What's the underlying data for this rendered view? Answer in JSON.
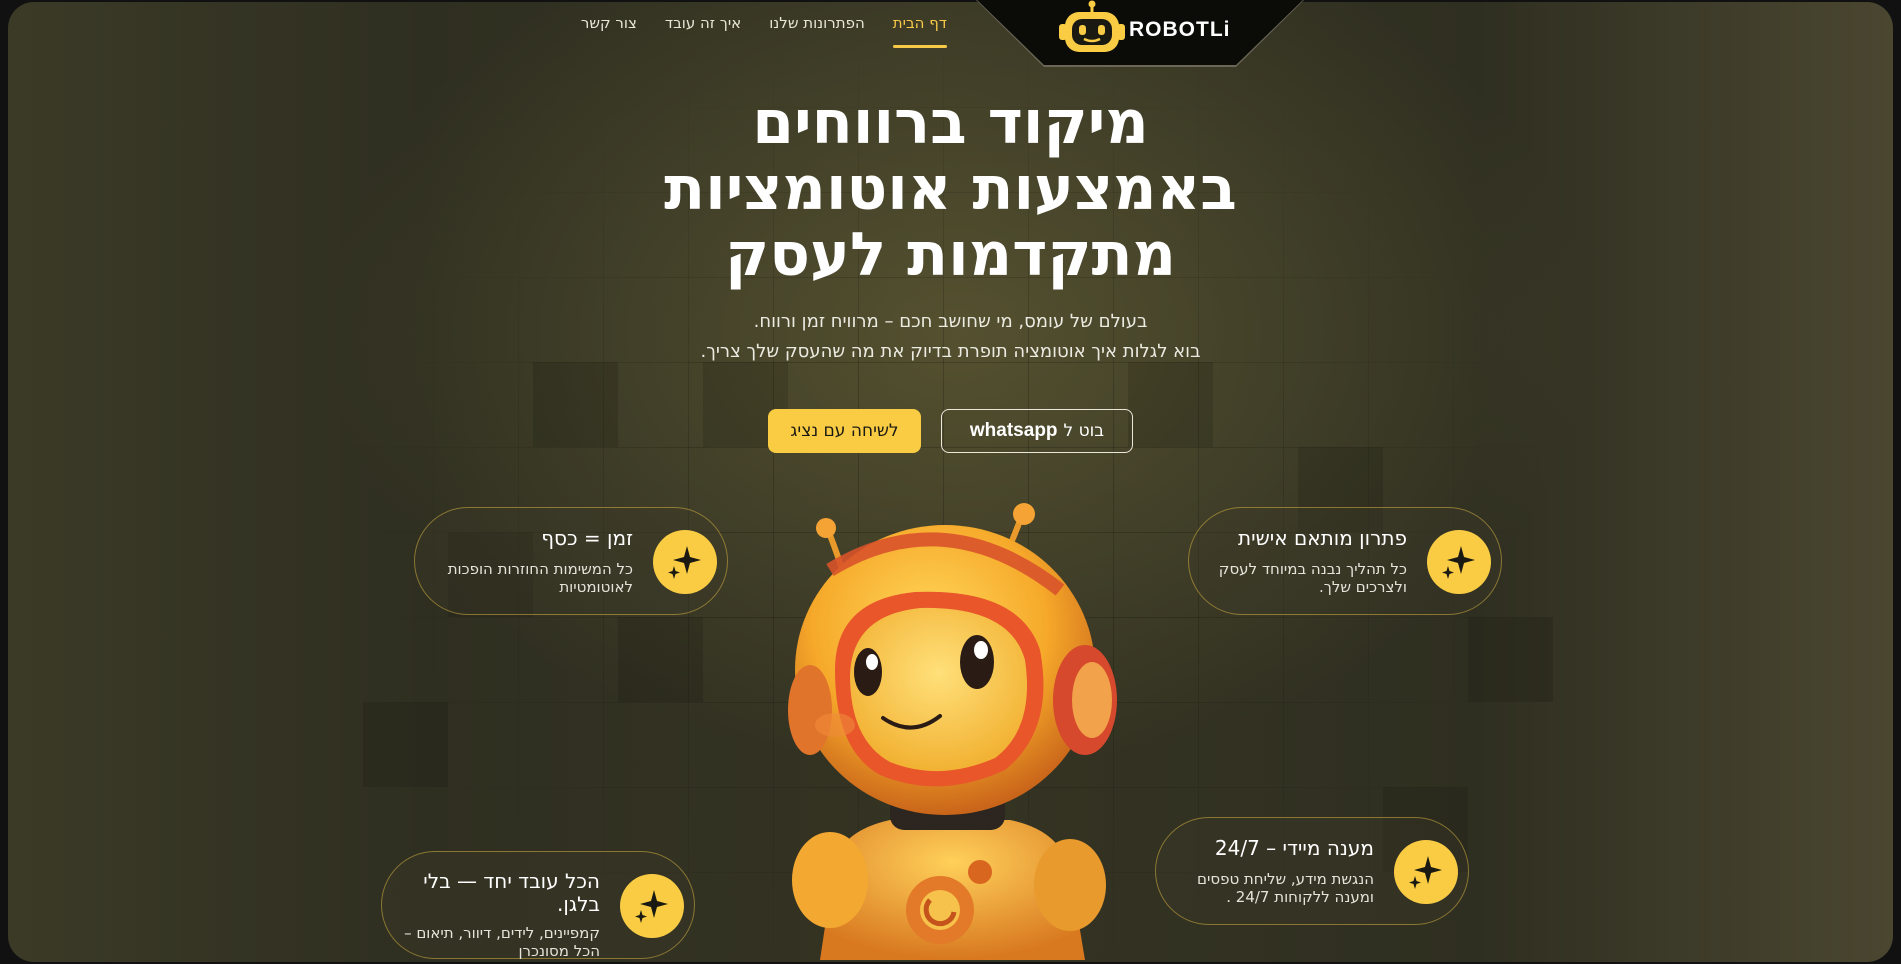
{
  "brand": {
    "name": "ROBOTLi",
    "logo_icon": "robot-head-icon",
    "accent": "#f9cc44"
  },
  "nav": {
    "items": [
      {
        "label": "דף הבית",
        "active": true
      },
      {
        "label": "הפתרונות שלנו",
        "active": false
      },
      {
        "label": "איך זה עובד",
        "active": false
      },
      {
        "label": "צור קשר",
        "active": false
      }
    ]
  },
  "hero": {
    "title_lines": [
      "מיקוד ברווחים",
      "באמצעות אוטומציות",
      "מתקדמות לעסק"
    ],
    "subtitle_lines": [
      "בעולם של עומס, מי שחושב חכם – מרוויח זמן ורווח.",
      "בוא לגלות איך אוטומציה תופרת בדיוק את מה שהעסק שלך צריך."
    ]
  },
  "buttons": {
    "talk": "לשיחה עם נציג",
    "bot_prefix": "בוט ל",
    "bot_brand": "whatsapp"
  },
  "features": [
    {
      "title": "פתרון מותאם אישית",
      "desc": "כל תהליך נבנה במיוחד לעסק ולצרכים שלך.",
      "icon": "sparkles-icon"
    },
    {
      "title": "זמן = כסף",
      "desc": "כל המשימות החוזרות הופכות לאוטומטיות",
      "icon": "sparkles-icon"
    },
    {
      "title": "מענה מיידי – 24/7",
      "desc": "הנגשת מידע, שליחת טפסים ומענה ללקוחות 24/7 .",
      "icon": "sparkles-icon"
    },
    {
      "title": "הכל עובד יחד — בלי בלגן.",
      "desc": "קמפיינים, לידים, דיוור, תיאום – הכל מסונכרן",
      "icon": "sparkles-icon"
    }
  ]
}
